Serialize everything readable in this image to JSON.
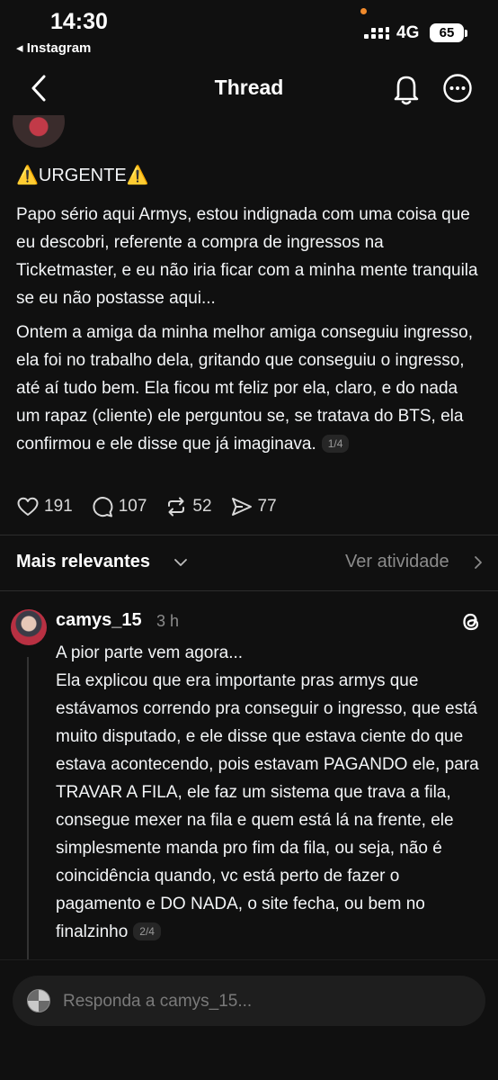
{
  "status_bar": {
    "time": "14:30",
    "back_app": "Instagram",
    "network": "4G",
    "battery": "65"
  },
  "header": {
    "title": "Thread",
    "icons": [
      "back-chevron-icon",
      "bell-icon",
      "more-options-icon"
    ]
  },
  "post": {
    "urgent_label": "⚠️URGENTE⚠️",
    "paragraph_1": "Papo sério aqui Armys, estou indignada com uma coisa que eu descobri, referente a compra de ingressos na Ticketmaster, e eu não iria ficar com a minha mente tranquila se eu não postasse aqui...",
    "paragraph_2": "Ontem a amiga da minha melhor amiga conseguiu ingresso, ela foi no trabalho dela, gritando que conseguiu o ingresso, até aí tudo bem. Ela ficou mt feliz por ela, claro, e do nada um rapaz (cliente) ele perguntou se, se tratava do BTS, ela confirmou e ele disse que já imaginava.",
    "page": "1/4",
    "likes": "191",
    "comments": "107",
    "reposts": "52",
    "shares": "77"
  },
  "sort": {
    "label": "Mais relevantes",
    "activity_label": "Ver atividade"
  },
  "reply": {
    "username": "camys_15",
    "time": "3 h",
    "line_1": "A pior parte vem agora...",
    "line_2": "Ela explicou que era importante pras armys que estávamos correndo pra conseguir o ingresso, que está muito disputado, e ele disse que estava ciente do que estava acontecendo, pois estavam PAGANDO ele, para TRAVAR A FILA, ele faz um sistema que trava a fila, consegue mexer na fila e quem está lá na frente, ele simplesmente manda pro fim da fila, ou seja, não é coincidência quando, vc está perto de fazer o pagamento e DO NADA, o site fecha, ou bem no finalzinho",
    "page": "2/4"
  },
  "composer": {
    "placeholder": "Responda a camys_15..."
  },
  "colors": {
    "background": "#101010",
    "text": "#f3f5f7",
    "muted": "#8b8b8b",
    "accent_dot": "#f08a2c"
  }
}
